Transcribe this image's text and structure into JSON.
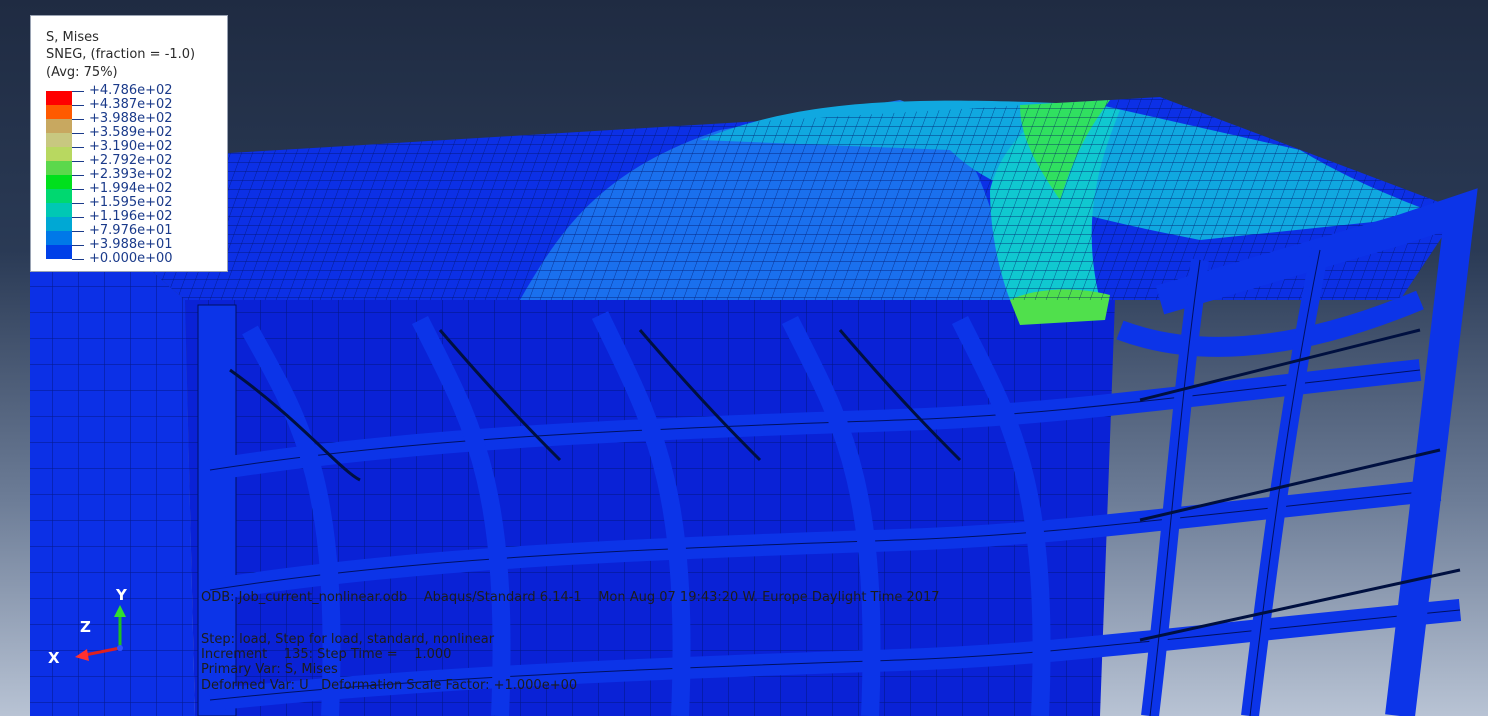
{
  "legend": {
    "title": "S, Mises",
    "subtitle": "SNEG, (fraction = -1.0)",
    "avg": "(Avg: 75%)",
    "values": [
      "+4.786e+02",
      "+4.387e+02",
      "+3.988e+02",
      "+3.589e+02",
      "+3.190e+02",
      "+2.792e+02",
      "+2.393e+02",
      "+1.994e+02",
      "+1.595e+02",
      "+1.196e+02",
      "+7.976e+01",
      "+3.988e+01",
      "+0.000e+00"
    ],
    "colors": [
      "#ff0000",
      "#ff5a00",
      "#c8a860",
      "#c8c880",
      "#b8d860",
      "#5cd84c",
      "#00e01c",
      "#00d870",
      "#00c8b4",
      "#00a8d4",
      "#0078e8",
      "#0040e8",
      "#0018d0"
    ]
  },
  "info": {
    "odb_line": "ODB: Job_current_nonlinear.odb    Abaqus/Standard 6.14-1    Mon Aug 07 19:43:20 W. Europe Daylight Time 2017",
    "step_line": "Step: load, Step for load, standard, nonlinear",
    "increment_line": "Increment    135: Step Time =    1.000",
    "primary_line": "Primary Var: S, Mises",
    "deformed_line": "Deformed Var: U   Deformation Scale Factor: +1.000e+00"
  },
  "triad": {
    "y": "Y",
    "z": "Z",
    "x": "X"
  },
  "model": {
    "colors": {
      "low": "#0a22d6",
      "base": "#0c30e6",
      "mid": "#1a70ee",
      "cyan": "#10c8d0",
      "green": "#30e060",
      "mesh": "#001060"
    }
  }
}
